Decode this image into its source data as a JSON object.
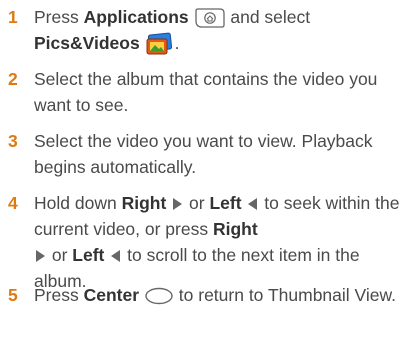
{
  "steps": [
    {
      "num": "1",
      "t1": "Press ",
      "b1": "Applications",
      "t2": " and select",
      "b2": "Pics&Videos",
      "t3": "."
    },
    {
      "num": "2",
      "t1": "Select the album that contains the video you want to see."
    },
    {
      "num": "3",
      "t1": "Select the video you want to view. Playback begins automatically."
    },
    {
      "num": "4",
      "t1": "Hold down ",
      "b1": "Right",
      "t2": " or ",
      "b2": "Left",
      "t3": " to seek within the current video, or press ",
      "b3": "Right",
      "t4": " or ",
      "b4": "Left",
      "t5": " to scroll to the next item in the album."
    },
    {
      "num": "5",
      "t1": "Press ",
      "b1": "Center",
      "t2": " to return to Thumbnail View."
    }
  ],
  "icons": {
    "applications": "applications-key-icon",
    "pics_videos": "pics-videos-app-icon",
    "right": "right-arrow-icon",
    "left": "left-arrow-icon",
    "center": "center-button-icon"
  },
  "colors": {
    "step_number": "#e07a10",
    "text": "#4a4a4a"
  }
}
